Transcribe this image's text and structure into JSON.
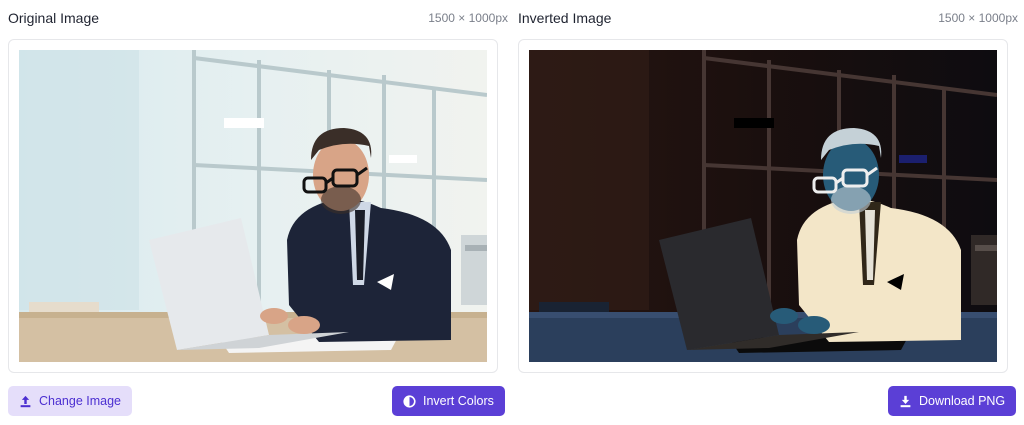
{
  "original": {
    "title": "Original Image",
    "dimensions": "1500 × 1000px",
    "image_alt": "Man with glasses in suit working on laptop in office",
    "change_button": {
      "label": "Change Image",
      "icon": "upload-icon"
    },
    "invert_button": {
      "label": "Invert Colors",
      "icon": "contrast-icon"
    }
  },
  "inverted": {
    "title": "Inverted Image",
    "dimensions": "1500 × 1000px",
    "image_alt": "Color-inverted version of the office photo",
    "download_button": {
      "label": "Download PNG",
      "icon": "download-icon"
    }
  },
  "colors": {
    "accent": "#5b3fd6",
    "accent_light": "#e5defa",
    "accent_text": "#4c2fd1"
  }
}
